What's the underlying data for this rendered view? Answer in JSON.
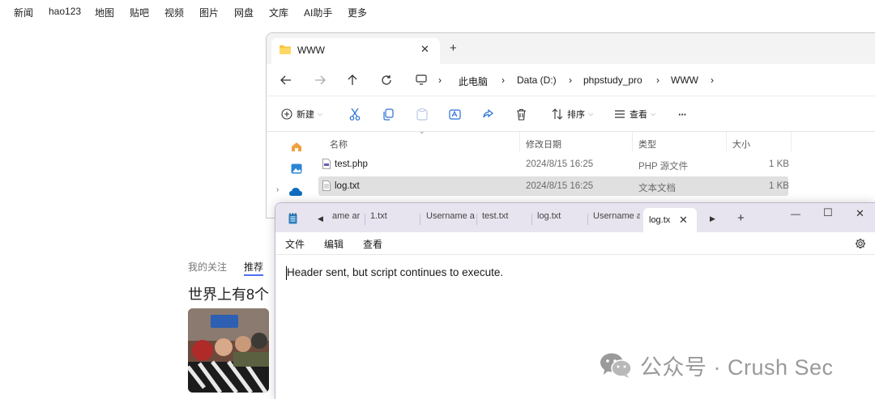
{
  "browser": {
    "nav": [
      "新闻",
      "hao123",
      "地图",
      "贴吧",
      "视频",
      "图片",
      "网盘",
      "文库",
      "AI助手",
      "更多"
    ],
    "feed_tabs": {
      "mine": "我的关注",
      "recommended": "推荐"
    },
    "headline": "世界上有8个",
    "accent_color": "#4e6ef2"
  },
  "explorer": {
    "tab_title": "WWW",
    "nav_icons": [
      "back-arrow-icon",
      "forward-arrow-icon",
      "up-arrow-icon",
      "refresh-icon"
    ],
    "breadcrumb": [
      "此电脑",
      "Data (D:)",
      "phpstudy_pro",
      "WWW"
    ],
    "toolbar": {
      "new_label": "新建",
      "sort_label": "排序",
      "view_label": "查看",
      "more_label": "···"
    },
    "columns": {
      "name": "名称",
      "date": "修改日期",
      "type": "类型",
      "size": "大小"
    },
    "files": [
      {
        "name": "test.php",
        "date": "2024/8/15 16:25",
        "type": "PHP 源文件",
        "size": "1 KB"
      },
      {
        "name": "log.txt",
        "date": "2024/8/15 16:25",
        "type": "文本文档",
        "size": "1 KB",
        "selected": true
      }
    ]
  },
  "notepad": {
    "tabs": [
      "ame ar",
      "1.txt",
      "Username ar",
      "test.txt",
      "log.txt",
      "Username ar"
    ],
    "active_tab": "log.tx",
    "menu": [
      "文件",
      "编辑",
      "查看"
    ],
    "content": "Header sent, but script continues to execute.",
    "window_controls": {
      "minimize": "—",
      "maximize": "☐",
      "close": "✕"
    }
  },
  "watermark": "公众号 · Crush Sec"
}
